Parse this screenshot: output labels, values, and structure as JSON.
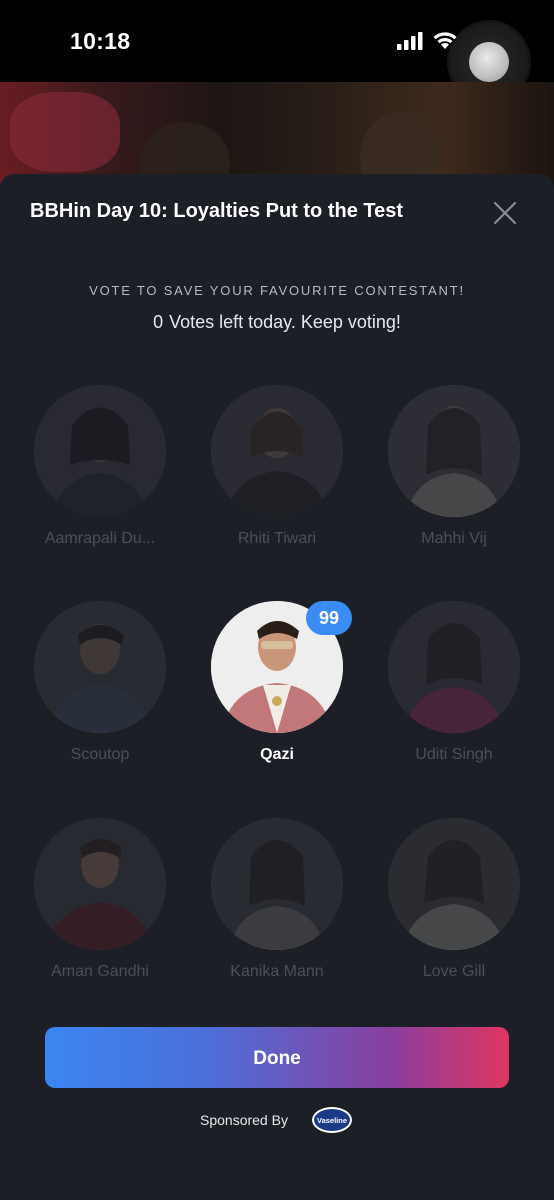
{
  "status_bar": {
    "time": "10:18"
  },
  "sheet": {
    "title": "BBHin Day 10: Loyalties Put to the Test",
    "prompt": "VOTE TO SAVE YOUR FAVOURITE CONTESTANT!",
    "votes_left_count": "0",
    "votes_left_text": "Votes left today. Keep voting!"
  },
  "contestants": [
    {
      "name": "Aamrapali Du...",
      "selected": false
    },
    {
      "name": "Rhiti Tiwari",
      "selected": false
    },
    {
      "name": "Mahhi Vij",
      "selected": false
    },
    {
      "name": "Scoutop",
      "selected": false
    },
    {
      "name": "Qazi",
      "selected": true,
      "votes": "99"
    },
    {
      "name": "Uditi Singh",
      "selected": false
    },
    {
      "name": "Aman Gandhi",
      "selected": false
    },
    {
      "name": "Kanika Mann",
      "selected": false
    },
    {
      "name": "Love Gill",
      "selected": false
    }
  ],
  "done_button": {
    "label": "Done"
  },
  "sponsor": {
    "label": "Sponsored By",
    "logo_text": "Vaseline"
  },
  "colors": {
    "sheet_bg": "#1d1f26",
    "badge": "#3a8cf5",
    "done_gradient_start": "#3a86f2",
    "done_gradient_end": "#e03561"
  }
}
